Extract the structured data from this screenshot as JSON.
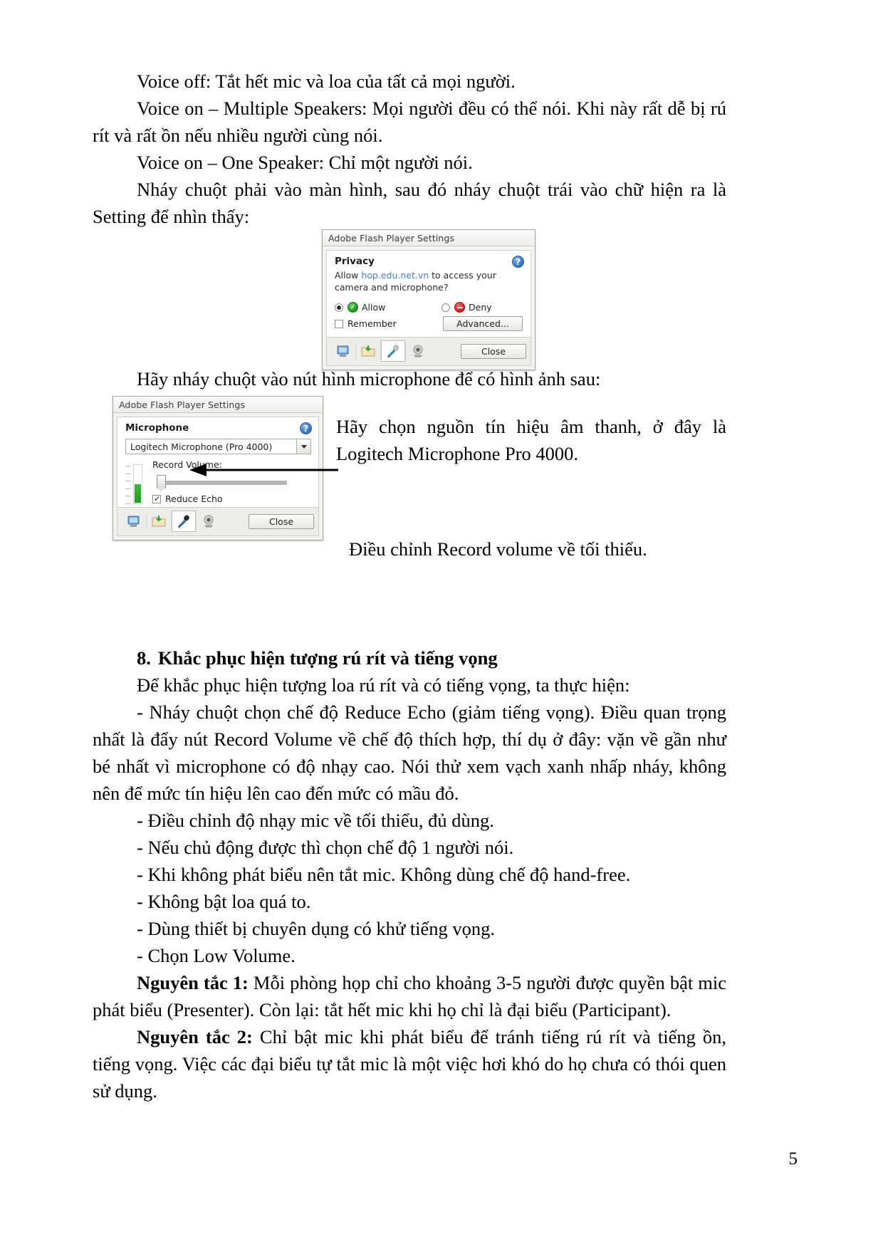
{
  "document": {
    "page_number": "5",
    "paragraphs": [
      "Voice off: Tắt hết mic và loa của tất cả mọi người.",
      "Voice on – Multiple Speakers: Mọi người đều có thể nói. Khi này rất dễ bị rú rít và rất ồn nếu nhiều người cùng nói.",
      "Voice on – One Speaker: Chỉ một người nói.",
      "Nháy chuột phải vào màn hình, sau đó nháy chuột trái vào chữ hiện ra là Setting để nhìn thấy:"
    ],
    "caption_after_privacy": "Hãy nháy chuột vào nút hình microphone để có hình ảnh sau:",
    "side_note_1": "Hãy chọn nguồn tín hiệu âm thanh, ở đây là Logitech Microphone Pro 4000.",
    "side_note_2": "Điều chỉnh Record volume về tối thiểu."
  },
  "section8": {
    "number": "8.",
    "title": "Khắc phục hiện tượng rú rít và tiếng vọng",
    "intro": "Để khắc phục hiện tượng loa rú rít và có tiếng vọng, ta thực hiện:",
    "bullets": [
      "- Nháy chuột chọn chế độ Reduce Echo (giảm tiếng vọng). Điều quan trọng nhất là đẩy nút Record Volume về chế độ thích hợp, thí dụ ở đây: vặn về gần như bé nhất vì microphone có độ nhạy cao. Nói thử xem vạch xanh nhấp nháy, không nên để mức tín hiệu lên cao đến mức có mầu đỏ.",
      "- Điều chỉnh độ nhạy mic về tối thiểu, đủ dùng.",
      "- Nếu chủ động được thì chọn chế độ 1 người nói.",
      "- Khi không phát biểu nên tắt mic. Không dùng chế độ hand-free.",
      "- Không bật loa quá to.",
      "- Dùng thiết bị chuyên dụng có khử tiếng vọng.",
      "- Chọn Low Volume."
    ],
    "rule1_label": "Nguyên tắc 1:",
    "rule1_text": " Mỗi phòng họp chỉ cho khoảng 3-5 người được quyền bật mic phát biểu (Presenter). Còn lại: tắt hết mic khi họ chỉ là đại biểu (Participant).",
    "rule2_label": "Nguyên tắc 2:",
    "rule2_text": " Chỉ bật mic khi phát biểu để tránh tiếng rú rít và tiếng ồn, tiếng vọng. Việc các đại biểu tự tắt mic là một việc hơi khó do họ chưa có thói quen sử dụng."
  },
  "privacy_dialog": {
    "title": "Adobe Flash Player Settings",
    "heading": "Privacy",
    "question_prefix": "Allow ",
    "question_link": "hop.edu.net.vn",
    "question_suffix": " to access your camera and microphone?",
    "allow_label": "Allow",
    "deny_label": "Deny",
    "remember_label": "Remember",
    "advanced_label": "Advanced...",
    "close_label": "Close",
    "help_glyph": "?",
    "allow_selected": true,
    "deny_selected": false,
    "remember_checked": false,
    "toolbar_icons": [
      "notification-icon",
      "local-storage-icon",
      "microphone-icon",
      "camera-icon"
    ],
    "selected_toolbar_icon": "microphone-icon"
  },
  "microphone_dialog": {
    "title": "Adobe Flash Player Settings",
    "heading": "Microphone",
    "device_value": "Logitech Microphone (Pro 4000)",
    "record_volume_label": "Record Volume:",
    "reduce_echo_label": "Reduce Echo",
    "reduce_echo_checked": true,
    "close_label": "Close",
    "help_glyph": "?",
    "toolbar_icons": [
      "notification-icon",
      "local-storage-icon",
      "microphone-icon",
      "camera-icon"
    ],
    "selected_toolbar_icon": "microphone-icon"
  },
  "colors": {
    "link": "#4a7fc1",
    "allow_green": "#149014",
    "deny_red": "#cf1313",
    "meter_green": "#2aa82a",
    "dialog_bg": "#f2f2f0"
  }
}
